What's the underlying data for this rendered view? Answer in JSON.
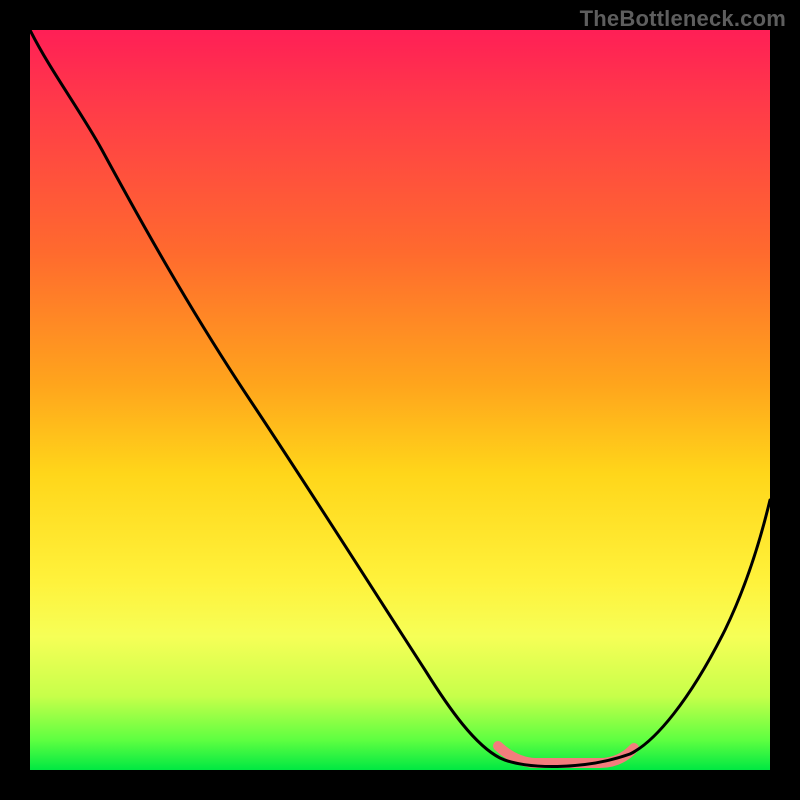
{
  "watermark": "TheBottleneck.com",
  "colors": {
    "background": "#000000",
    "gradient_top": "#ff1f56",
    "gradient_mid1": "#ff6a2e",
    "gradient_mid2": "#ffd61a",
    "gradient_bottom": "#00e842",
    "curve": "#000000",
    "band": "#f37d7d",
    "watermark_text": "#5e5e5e"
  },
  "chart_data": {
    "type": "line",
    "title": "",
    "xlabel": "",
    "ylabel": "",
    "xlim": [
      0,
      100
    ],
    "ylim": [
      0,
      100
    ],
    "grid": false,
    "series": [
      {
        "name": "bottleneck-curve",
        "x": [
          0,
          5,
          10,
          20,
          30,
          40,
          50,
          58,
          62,
          65,
          72,
          78,
          82,
          88,
          94,
          100
        ],
        "y": [
          100,
          95,
          90,
          77,
          63,
          49,
          34,
          19,
          9,
          2,
          0,
          0,
          3,
          13,
          26,
          40
        ]
      }
    ],
    "sweet_spot_band": {
      "x_start": 63,
      "x_end": 82
    },
    "notes": "V-shaped bottleneck % deviation curve over a vertical red→green gradient; minimum (green sweet spot) near x≈65–80. Values estimated from pixel positions."
  }
}
